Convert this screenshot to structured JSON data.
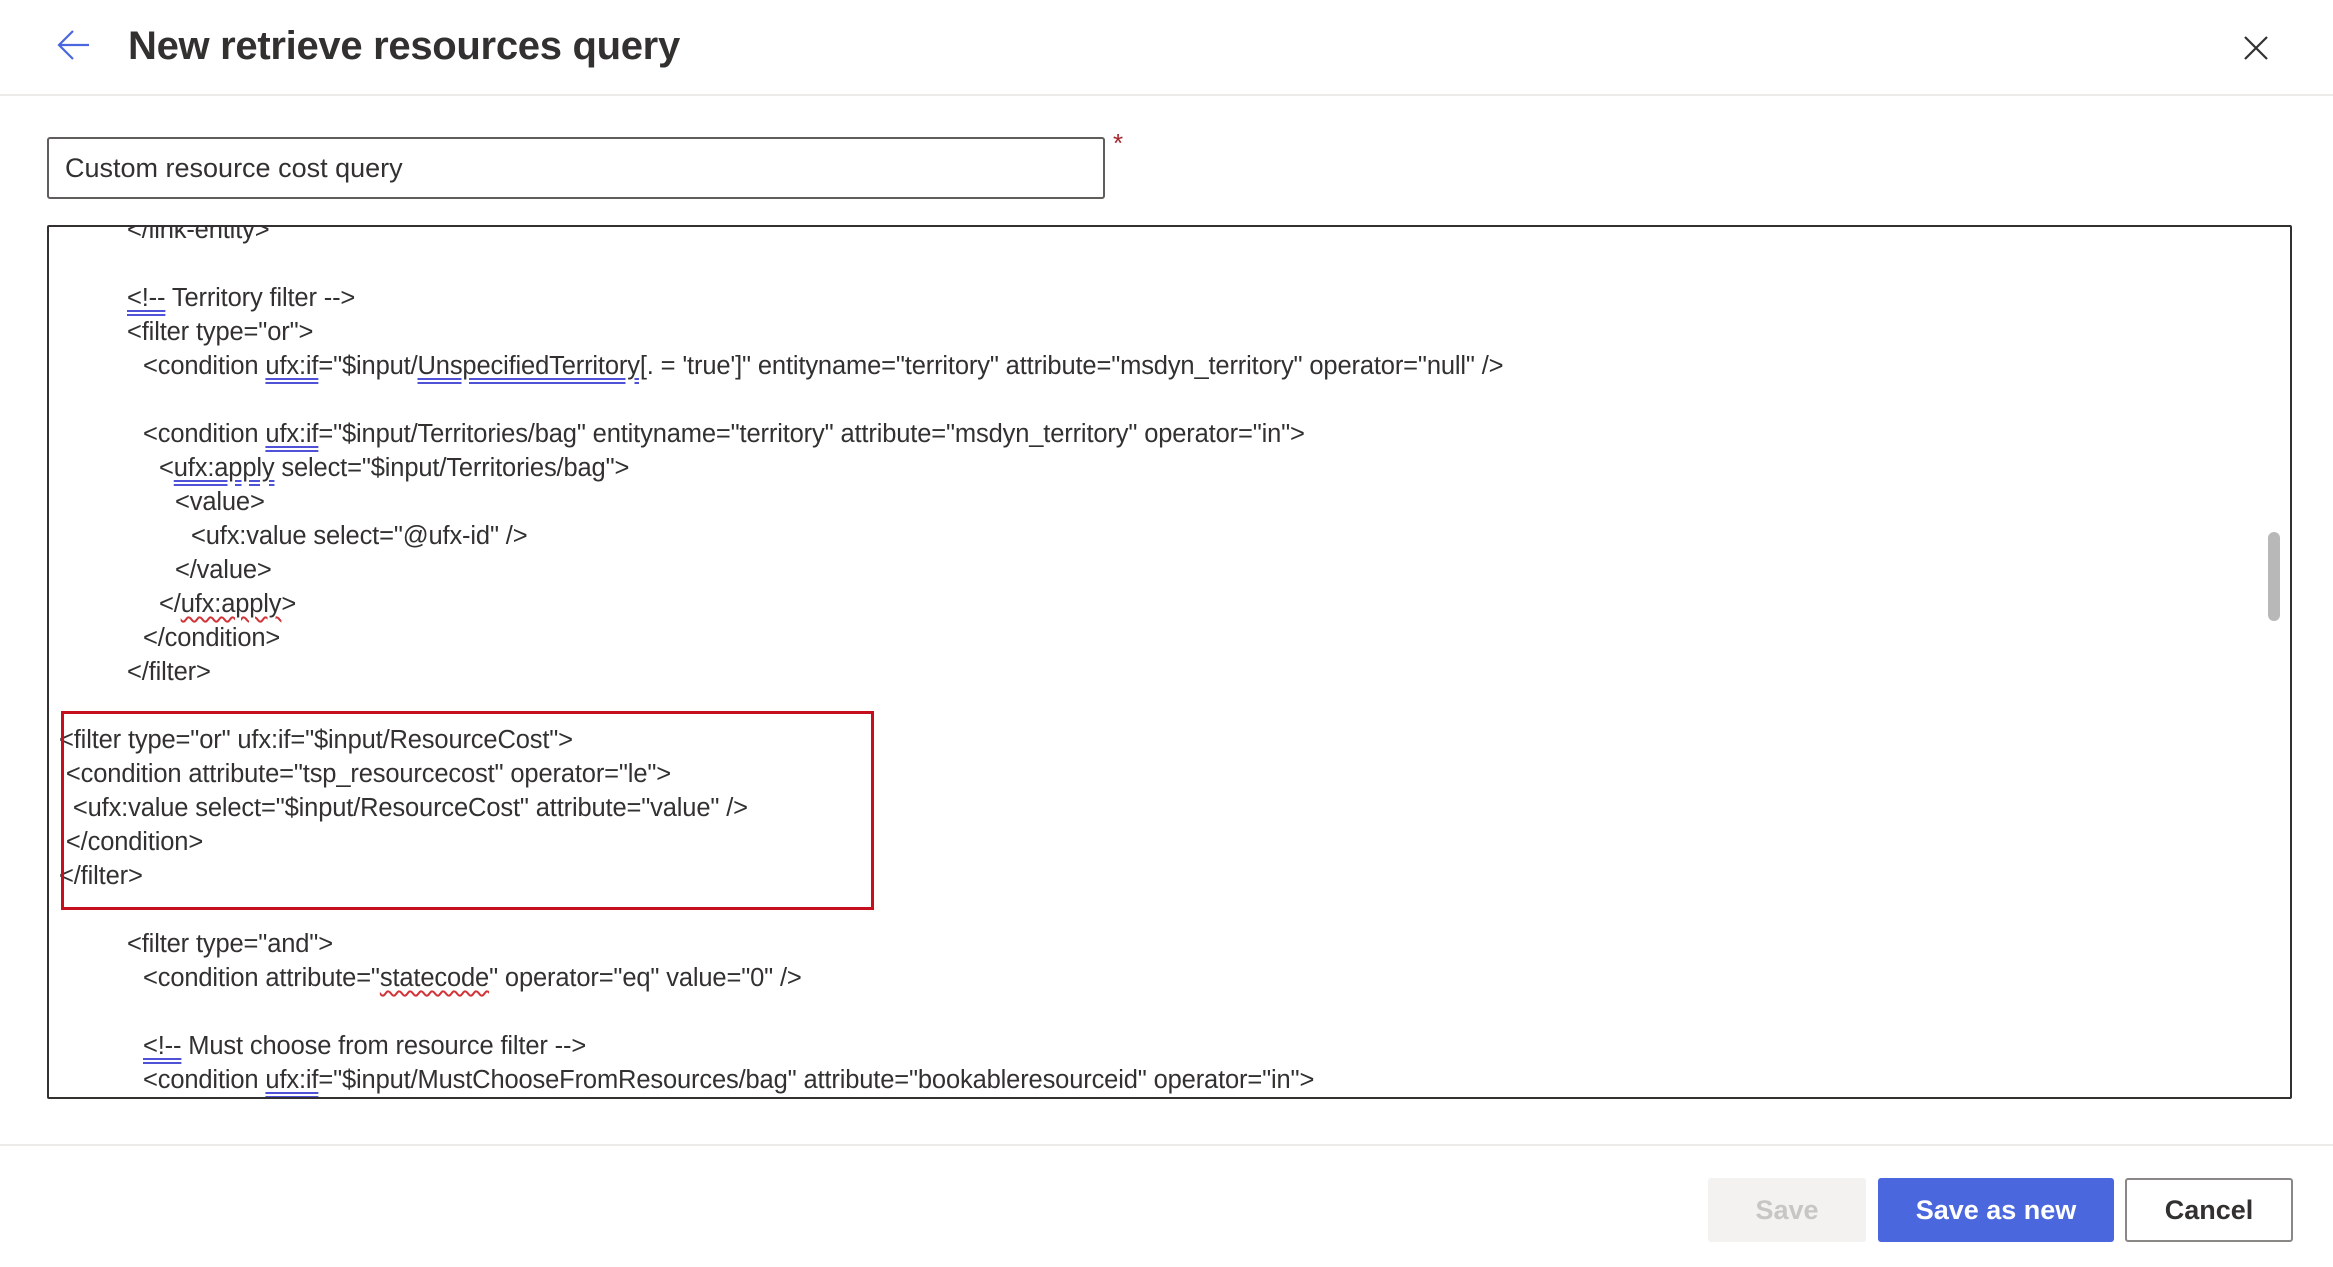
{
  "header": {
    "title": "New retrieve resources query",
    "back_icon": "arrow-left-icon",
    "close_icon": "close-icon"
  },
  "form": {
    "name_value": "Custom resource cost query",
    "required_marker": "*"
  },
  "editor": {
    "lines": [
      {
        "indent": 4,
        "segments": [
          {
            "t": "</link-entity>"
          }
        ]
      },
      {
        "indent": 0,
        "segments": [
          {
            "t": ""
          }
        ]
      },
      {
        "indent": 4,
        "segments": [
          {
            "t": "<!--",
            "u": "blue"
          },
          {
            "t": " Territory filter -->"
          }
        ]
      },
      {
        "indent": 4,
        "segments": [
          {
            "t": "<filter type=\"or\">"
          }
        ]
      },
      {
        "indent": 5,
        "segments": [
          {
            "t": "<condition "
          },
          {
            "t": "ufx:if",
            "u": "blue"
          },
          {
            "t": "=\"$input/"
          },
          {
            "t": "UnspecifiedTerritory[",
            "u": "blue"
          },
          {
            "t": ". = 'true']\" entityname=\"territory\" attribute=\"msdyn_territory\" operator=\"null\" />"
          }
        ]
      },
      {
        "indent": 0,
        "segments": [
          {
            "t": ""
          }
        ]
      },
      {
        "indent": 5,
        "segments": [
          {
            "t": "<condition "
          },
          {
            "t": "ufx:if",
            "u": "blue"
          },
          {
            "t": "=\"$input/Territories/bag\" entityname=\"territory\" attribute=\"msdyn_territory\" operator=\"in\">"
          }
        ]
      },
      {
        "indent": 6,
        "segments": [
          {
            "t": "<"
          },
          {
            "t": "ufx:apply",
            "u": "blue"
          },
          {
            "t": " select=\"$input/Territories/bag\">"
          }
        ]
      },
      {
        "indent": 7,
        "segments": [
          {
            "t": "<value>"
          }
        ]
      },
      {
        "indent": 8,
        "segments": [
          {
            "t": "<ufx:value select=\"@ufx-id\" />"
          }
        ]
      },
      {
        "indent": 7,
        "segments": [
          {
            "t": "</value>"
          }
        ]
      },
      {
        "indent": 6,
        "segments": [
          {
            "t": "</"
          },
          {
            "t": "ufx:apply",
            "u": "red"
          },
          {
            "t": ">"
          }
        ]
      },
      {
        "indent": 5,
        "segments": [
          {
            "t": "</condition>"
          }
        ]
      },
      {
        "indent": 4,
        "segments": [
          {
            "t": "</filter>"
          }
        ]
      },
      {
        "indent": 0,
        "segments": [
          {
            "t": ""
          }
        ]
      },
      {
        "indent": 0,
        "segments": [
          {
            "t": "<filter type=\"or\" ufx:if=\"$input/ResourceCost\">"
          }
        ]
      },
      {
        "indent": 0,
        "segments": [
          {
            "t": " <condition attribute=\"tsp_resourcecost\" operator=\"le\">"
          }
        ]
      },
      {
        "indent": 0,
        "segments": [
          {
            "t": "  <ufx:value select=\"$input/ResourceCost\" attribute=\"value\" />"
          }
        ]
      },
      {
        "indent": 0,
        "segments": [
          {
            "t": " </condition>"
          }
        ]
      },
      {
        "indent": 0,
        "segments": [
          {
            "t": "</filter>"
          }
        ]
      },
      {
        "indent": 0,
        "segments": [
          {
            "t": ""
          }
        ]
      },
      {
        "indent": 4,
        "segments": [
          {
            "t": "<filter type=\"and\">"
          }
        ]
      },
      {
        "indent": 5,
        "segments": [
          {
            "t": "<condition attribute=\""
          },
          {
            "t": "statecode",
            "u": "red"
          },
          {
            "t": "\" operator=\"eq\" value=\"0\" />"
          }
        ]
      },
      {
        "indent": 0,
        "segments": [
          {
            "t": ""
          }
        ]
      },
      {
        "indent": 5,
        "segments": [
          {
            "t": "<!--",
            "u": "blue"
          },
          {
            "t": " Must choose from resource filter -->"
          }
        ]
      },
      {
        "indent": 5,
        "segments": [
          {
            "t": "<condition "
          },
          {
            "t": "ufx:if",
            "u": "blue"
          },
          {
            "t": "=\"$input/MustChooseFromResources/bag\" attribute=\"bookableresourceid\" operator=\"in\">"
          }
        ]
      }
    ],
    "highlighted_lines": [
      15,
      19
    ]
  },
  "footer": {
    "save_label": "Save",
    "save_as_new_label": "Save as new",
    "cancel_label": "Cancel"
  },
  "colors": {
    "accent": "#4a67dd",
    "highlight_border": "#c50f1f",
    "required": "#a4262c"
  }
}
